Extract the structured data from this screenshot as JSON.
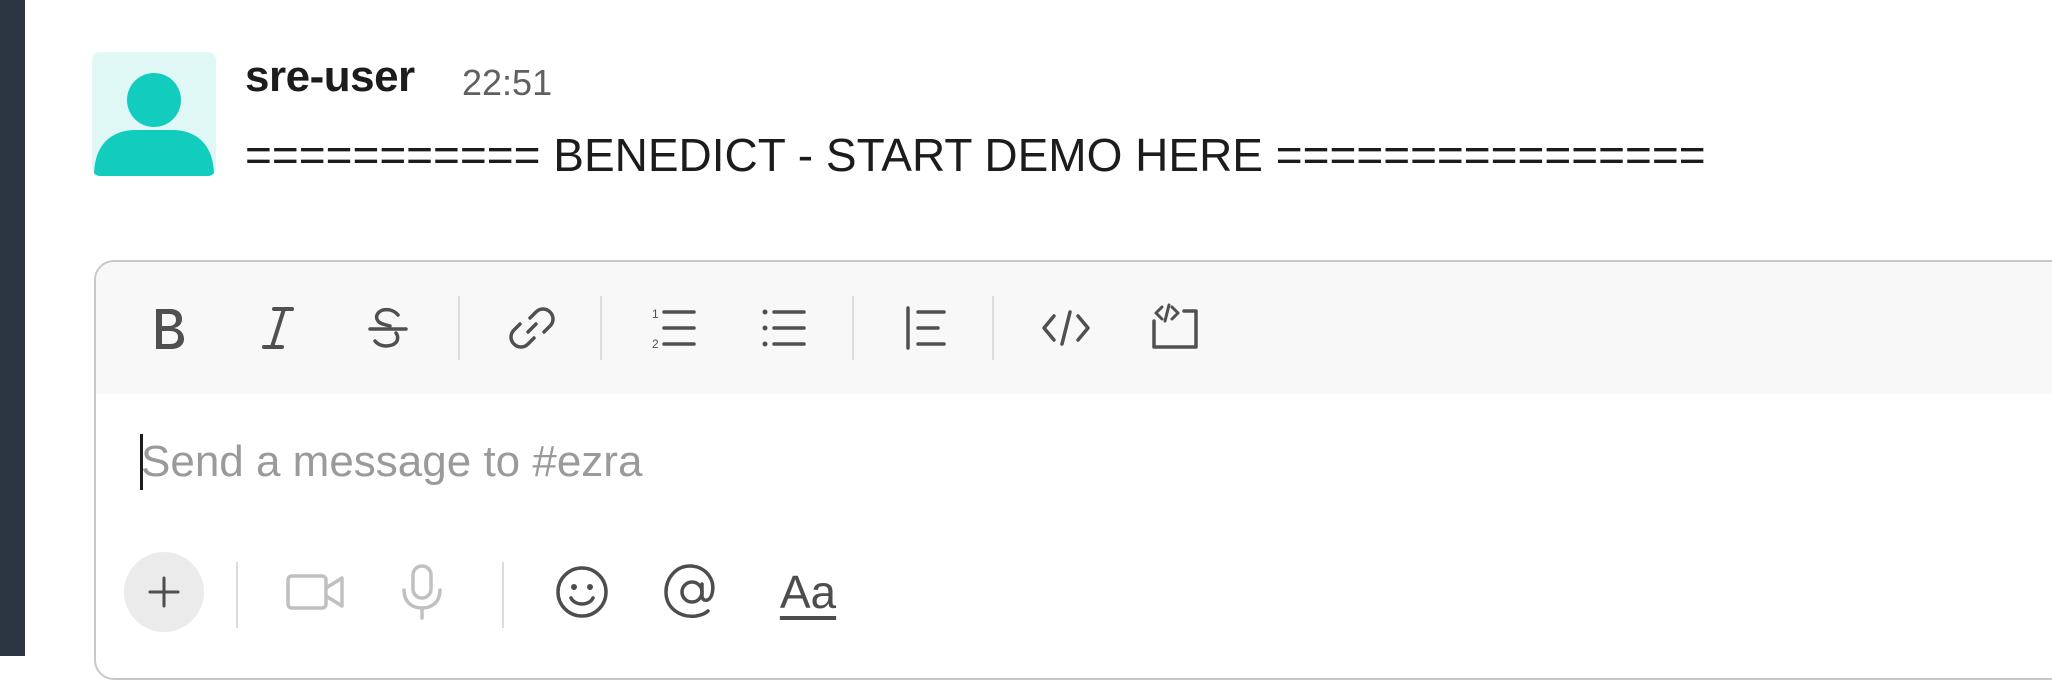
{
  "message": {
    "author": "sre-user",
    "time": "22:51",
    "text": "=========== BENEDICT - START DEMO HERE ================"
  },
  "composer": {
    "placeholder": "Send a message to #ezra",
    "text_style_label": "Aa",
    "toolbar": [
      {
        "name": "bold-icon"
      },
      {
        "name": "italic-icon"
      },
      {
        "name": "strikethrough-icon"
      },
      {
        "name": "link-icon"
      },
      {
        "name": "ordered-list-icon"
      },
      {
        "name": "bulleted-list-icon"
      },
      {
        "name": "blockquote-icon"
      },
      {
        "name": "code-icon"
      },
      {
        "name": "code-block-icon"
      }
    ],
    "bottom_actions": [
      {
        "name": "plus-icon"
      },
      {
        "name": "video-icon"
      },
      {
        "name": "microphone-icon"
      },
      {
        "name": "emoji-icon"
      },
      {
        "name": "mention-icon"
      },
      {
        "name": "text-format-icon"
      }
    ]
  },
  "colors": {
    "avatar_bg": "#e0f8f5",
    "avatar_fg": "#12cdbe",
    "rail": "#2c3542"
  }
}
